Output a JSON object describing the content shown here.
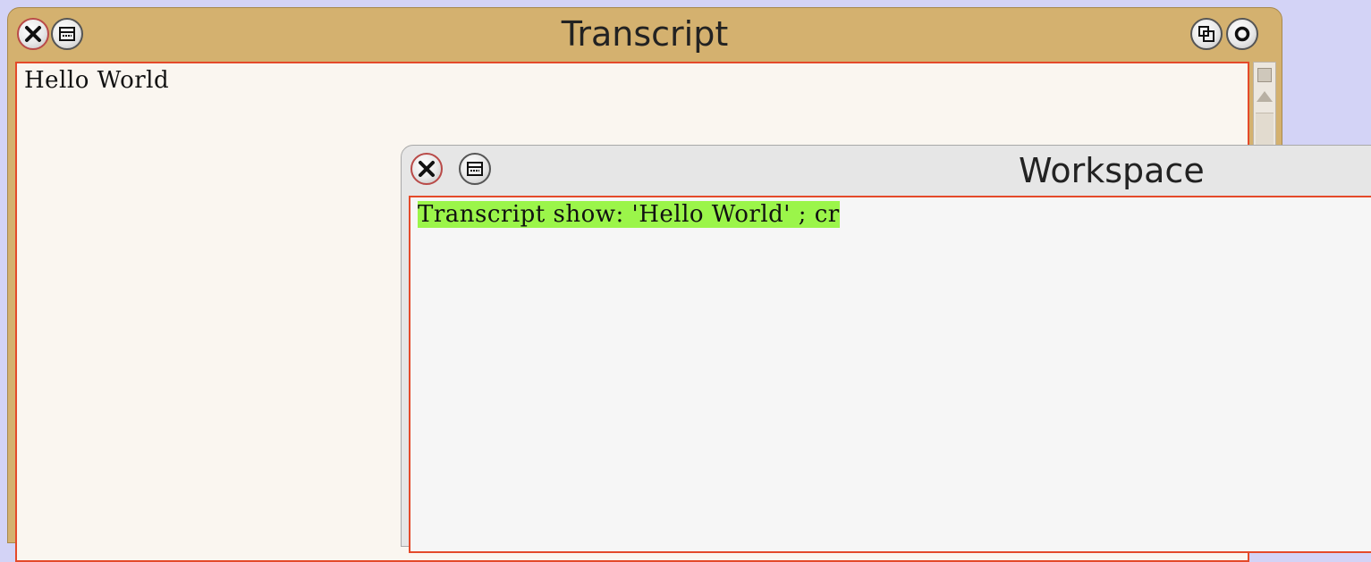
{
  "transcript": {
    "title": "Transcript",
    "content": "Hello World",
    "buttons": {
      "close_icon": "close-icon",
      "menu_icon": "window-menu-icon",
      "collapse_icon": "collapse-icon",
      "expand_icon": "expand-icon"
    }
  },
  "workspace": {
    "title": "Workspace",
    "content": "Transcript show: 'Hello World' ; cr",
    "selection_color": "#9bf54a",
    "buttons": {
      "close_icon": "close-icon",
      "menu_icon": "window-menu-icon"
    }
  },
  "colors": {
    "desktop": "#d3d3f6",
    "transcript_titlebar": "#d4b16f",
    "workspace_titlebar": "#e6e6e6",
    "pane_border": "#e44a2a"
  }
}
